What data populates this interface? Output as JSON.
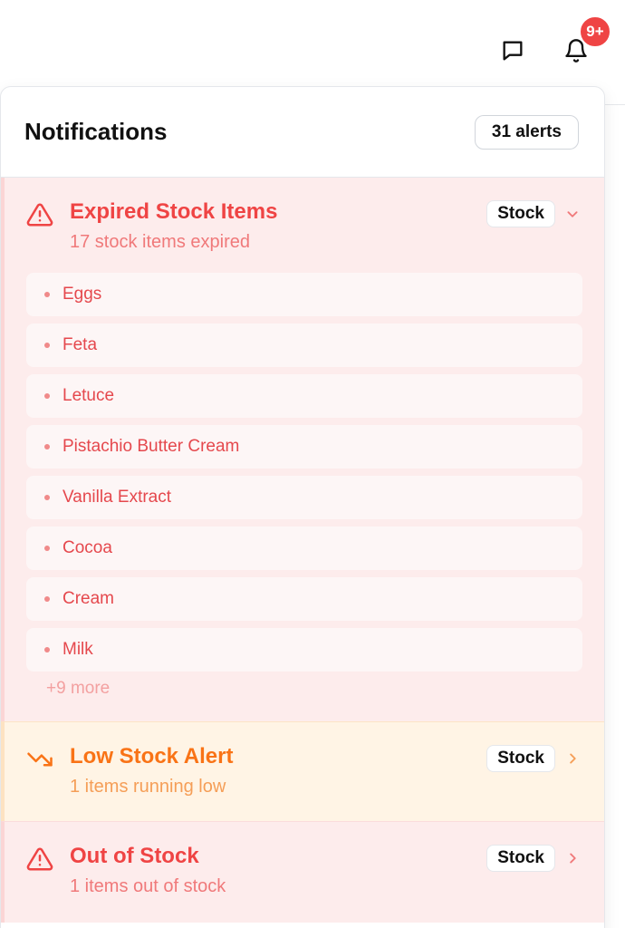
{
  "topbar": {
    "message_icon": "message-square-icon",
    "bell_icon": "bell-icon",
    "badge": "9+"
  },
  "panel": {
    "title": "Notifications",
    "count": "31 alerts"
  },
  "groups": [
    {
      "icon": "alert-triangle-icon",
      "title": "Expired Stock Items",
      "subtitle": "17 stock items expired",
      "tag": "Stock",
      "expanded": true,
      "items": [
        "Eggs",
        "Feta",
        "Letuce",
        "Pistachio Butter Cream",
        "Vanilla Extract",
        "Cocoa",
        "Cream",
        "Milk"
      ],
      "more": "+9 more",
      "color": "#ef4444"
    },
    {
      "icon": "trending-down-icon",
      "title": "Low Stock Alert",
      "subtitle": "1 items running low",
      "tag": "Stock",
      "expanded": false,
      "color": "#f97316"
    },
    {
      "icon": "alert-triangle-icon",
      "title": "Out of Stock",
      "subtitle": "1 items out of stock",
      "tag": "Stock",
      "expanded": false,
      "color": "#ef4444"
    }
  ]
}
